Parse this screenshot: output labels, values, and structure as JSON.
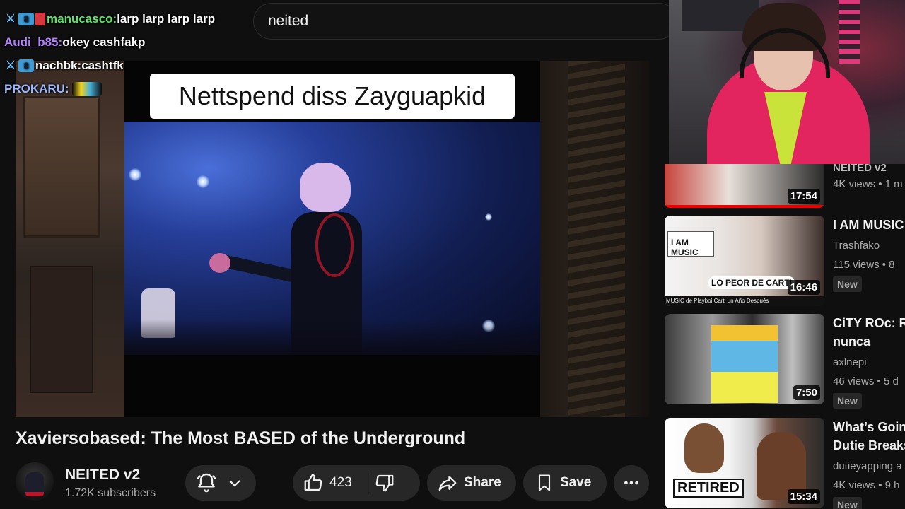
{
  "search": {
    "query": "neited"
  },
  "chat": [
    {
      "user": "manucasco:",
      "message": " larp larp larp larp"
    },
    {
      "user": "Audi_b85:",
      "message": " okey cashfakp"
    },
    {
      "user": "nachbk:",
      "message": " cashtfk"
    },
    {
      "user": "PROKARU:",
      "message": ""
    }
  ],
  "video": {
    "caption": "Nettspend diss Zayguapkid",
    "title": "Xaviersobased: The Most BASED of the Underground"
  },
  "channel": {
    "name": "NEITED v2",
    "subscribers": "1.72K subscribers"
  },
  "actions": {
    "likes": "423",
    "share": "Share",
    "save": "Save"
  },
  "sidebar": [
    {
      "title": "",
      "channel": "NEITED v2",
      "meta": "4K views • 1 m",
      "duration": "17:54",
      "new": "",
      "watched": 1.0
    },
    {
      "title": "I AM MUSIC",
      "channel": "Trashfako",
      "meta": "115 views • 8",
      "duration": "16:46",
      "new": "New",
      "watched": 0
    },
    {
      "title": "CiTY ROc: R",
      "title2": "nunca",
      "channel": "axlnepi",
      "meta": "46 views • 5 d",
      "duration": "7:50",
      "new": "New",
      "watched": 0
    },
    {
      "title": "What’s Goin",
      "title2": "Dutie Breaks",
      "channel": "dutieyapping a",
      "meta": "4K views • 9 h",
      "duration": "15:34",
      "new": "New",
      "watched": 0
    }
  ],
  "thumb_text": {
    "iam": "I AM MUSIC",
    "lopeor": "LO PEOR DE CARTI",
    "retired": "RETIRED",
    "subline": "MUSIC de Playboi Carti un Año Después"
  },
  "colors": {
    "accent": "#ff0000",
    "bg": "#0f0f0f",
    "pill": "#272727"
  }
}
